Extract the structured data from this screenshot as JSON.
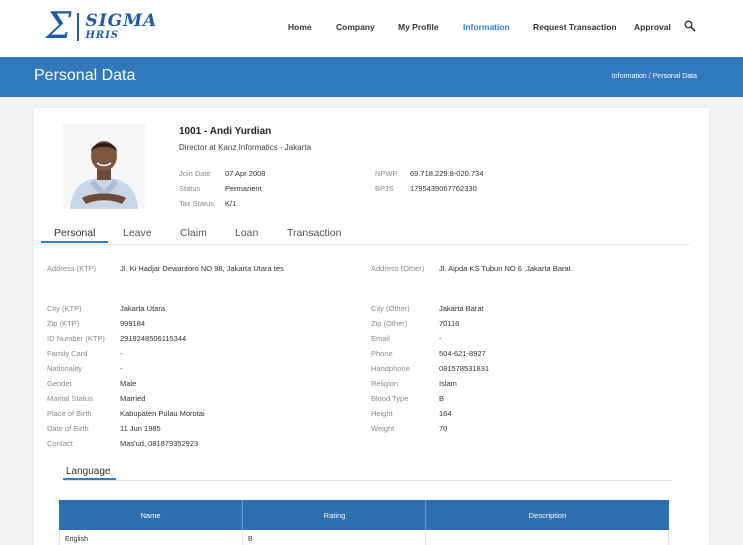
{
  "header": {
    "logo": {
      "symbol": "Σ",
      "name": "SIGMA",
      "sub": "HRIS"
    },
    "nav": [
      {
        "label": "Home"
      },
      {
        "label": "Company"
      },
      {
        "label": "My Profile"
      },
      {
        "label": "Information",
        "active": true
      },
      {
        "label": "Request Transaction"
      },
      {
        "label": "Approval"
      }
    ],
    "search_icon": "search-icon",
    "accent": "#2d7ed0"
  },
  "banner": {
    "title": "Personal Data",
    "breadcrumb": "Information / Personal Data",
    "color": "#3278bd"
  },
  "employee": {
    "photo_icon": "avatar",
    "name": "1001 - Andi Yurdian",
    "position": "Director at Kanz Informatics - Jakarta",
    "left_info": [
      {
        "label": "Join Date",
        "value": "07 Apr 2008"
      },
      {
        "label": "Status",
        "value": "Permanent"
      },
      {
        "label": "Tax Status",
        "value": "K/1"
      }
    ],
    "right_info": [
      {
        "label": "NPWP",
        "value": "69.718.229.8-020.734"
      },
      {
        "label": "BPJS",
        "value": "1795439067762330"
      }
    ]
  },
  "tabs": [
    {
      "label": "Personal",
      "active": true
    },
    {
      "label": "Leave"
    },
    {
      "label": "Claim"
    },
    {
      "label": "Loan"
    },
    {
      "label": "Transaction"
    }
  ],
  "personal": {
    "address_ktp": {
      "label": "Address (KTP)",
      "value": "Jl. Ki Hadjar Dewantoro NO 98, Jakarta Utara tes"
    },
    "address_other": {
      "label": "Address (Other)",
      "value": "Jl. Aipda KS Tubun NO 6 ,Jakarta Barat"
    },
    "left": [
      {
        "label": "City (KTP)",
        "value": "Jakarta Utara"
      },
      {
        "label": "Zip (KTP)",
        "value": "999184"
      },
      {
        "label": "ID Number (KTP)",
        "value": "2919248506115344"
      },
      {
        "label": "Family Card",
        "value": "-"
      },
      {
        "label": "Nationality",
        "value": "-"
      },
      {
        "label": "Gender",
        "value": "Male"
      },
      {
        "label": "Marital Status",
        "value": "Married"
      },
      {
        "label": "Place of Birth",
        "value": "Kabupaten Pulau Morotai"
      },
      {
        "label": "Date of Birth",
        "value": "11 Jun 1985"
      },
      {
        "label": "Contact",
        "value": "Mas'ud, 081879352923"
      }
    ],
    "right": [
      {
        "label": "City (Other)",
        "value": "Jakarta Barat"
      },
      {
        "label": "Zip (Other)",
        "value": "70116"
      },
      {
        "label": "Email",
        "value": "-"
      },
      {
        "label": "Phone",
        "value": "504-621-8927"
      },
      {
        "label": "Handphone",
        "value": "081578531831"
      },
      {
        "label": "Religion",
        "value": "Islam"
      },
      {
        "label": "Blood Type",
        "value": "B"
      },
      {
        "label": "Height",
        "value": "164"
      },
      {
        "label": "Weight",
        "value": "70"
      }
    ]
  },
  "language": {
    "title": "Language",
    "columns": [
      "Name",
      "Rating",
      "Description"
    ],
    "rows": [
      [
        "English",
        "B",
        ""
      ]
    ],
    "header_color": "#2e6fb0"
  }
}
